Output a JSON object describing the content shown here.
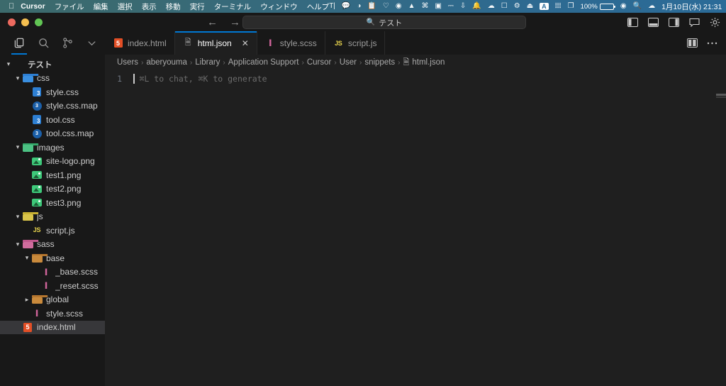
{
  "menubar": {
    "apple_icon": "apple-icon",
    "items": [
      "Cursor",
      "ファイル",
      "編集",
      "選択",
      "表示",
      "移動",
      "実行",
      "ターミナル",
      "ウィンドウ",
      "ヘルプ"
    ],
    "status_icons": [
      "text-input-icon",
      "speech-bubble-icon",
      "pie-chart-icon",
      "clipboard-icon",
      "heart-pulse-icon",
      "colorwheel-icon",
      "dropbox-icon",
      "command-icon",
      "screenshot-icon",
      "keyboard-icon",
      "download-icon",
      "notification-bell-icon",
      "vpn-icon",
      "display-icon",
      "screen-mirroring-icon",
      "control-center-icon",
      "eject-icon"
    ],
    "input_source": "A",
    "bluetooth_icon": "bluetooth-icon",
    "display_icon": "display-duplicate-icon",
    "battery_percent": "100%",
    "wifi_icon": "wifi-icon",
    "search_icon": "spotlight-icon",
    "siri_icon": "siri-icon",
    "datetime": "1月10日(水) 21:31"
  },
  "titlebar": {
    "back_icon": "back-arrow-icon",
    "forward_icon": "forward-arrow-icon",
    "quickpick_icon": "search-icon",
    "quickpick_value": "テスト",
    "actions": [
      {
        "name": "toggle-primary-sidebar-button",
        "icon": "layout-sidebar-left-icon"
      },
      {
        "name": "toggle-panel-button",
        "icon": "layout-panel-icon"
      },
      {
        "name": "toggle-secondary-sidebar-button",
        "icon": "layout-sidebar-right-icon"
      },
      {
        "name": "toggle-chat-button",
        "icon": "chat-panel-icon"
      },
      {
        "name": "settings-button",
        "icon": "gear-icon"
      }
    ]
  },
  "activitybar": {
    "items": [
      {
        "name": "explorer-icon",
        "label": "Explorer",
        "active": true
      },
      {
        "name": "search-icon",
        "label": "Search",
        "active": false
      },
      {
        "name": "source-control-icon",
        "label": "Source Control",
        "active": false
      },
      {
        "name": "chevron-down-icon",
        "label": "More",
        "active": false
      }
    ]
  },
  "explorer": {
    "tree": [
      {
        "label": "テスト",
        "depth": 0,
        "kind": "root",
        "twisty": "open",
        "selected": false
      },
      {
        "label": "css",
        "depth": 1,
        "kind": "folder-css",
        "twisty": "open",
        "selected": false
      },
      {
        "label": "style.css",
        "depth": 2,
        "kind": "css",
        "twisty": "none",
        "selected": false
      },
      {
        "label": "style.css.map",
        "depth": 2,
        "kind": "cssmap",
        "twisty": "none",
        "selected": false
      },
      {
        "label": "tool.css",
        "depth": 2,
        "kind": "css",
        "twisty": "none",
        "selected": false
      },
      {
        "label": "tool.css.map",
        "depth": 2,
        "kind": "cssmap",
        "twisty": "none",
        "selected": false
      },
      {
        "label": "images",
        "depth": 1,
        "kind": "folder-images",
        "twisty": "open",
        "selected": false
      },
      {
        "label": "site-logo.png",
        "depth": 2,
        "kind": "image",
        "twisty": "none",
        "selected": false
      },
      {
        "label": "test1.png",
        "depth": 2,
        "kind": "image",
        "twisty": "none",
        "selected": false
      },
      {
        "label": "test2.png",
        "depth": 2,
        "kind": "image",
        "twisty": "none",
        "selected": false
      },
      {
        "label": "test3.png",
        "depth": 2,
        "kind": "image",
        "twisty": "none",
        "selected": false
      },
      {
        "label": "js",
        "depth": 1,
        "kind": "folder-js",
        "twisty": "open",
        "selected": false
      },
      {
        "label": "script.js",
        "depth": 2,
        "kind": "js",
        "twisty": "none",
        "selected": false
      },
      {
        "label": "sass",
        "depth": 1,
        "kind": "folder-sass",
        "twisty": "open",
        "selected": false
      },
      {
        "label": "base",
        "depth": 2,
        "kind": "folder-base",
        "twisty": "open",
        "selected": false
      },
      {
        "label": "_base.scss",
        "depth": 3,
        "kind": "sass",
        "twisty": "none",
        "selected": false
      },
      {
        "label": "_reset.scss",
        "depth": 3,
        "kind": "sass",
        "twisty": "none",
        "selected": false
      },
      {
        "label": "global",
        "depth": 2,
        "kind": "folder-base",
        "twisty": "closed",
        "selected": false
      },
      {
        "label": "style.scss",
        "depth": 2,
        "kind": "sass",
        "twisty": "none",
        "selected": false
      },
      {
        "label": "index.html",
        "depth": 1,
        "kind": "html",
        "twisty": "none",
        "selected": true
      }
    ]
  },
  "tabs": [
    {
      "label": "index.html",
      "kind": "html",
      "active": false,
      "closable": false
    },
    {
      "label": "html.json",
      "kind": "json",
      "active": true,
      "closable": true,
      "close_icon": "close-icon"
    },
    {
      "label": "style.scss",
      "kind": "sass",
      "active": false,
      "closable": false
    },
    {
      "label": "script.js",
      "kind": "js",
      "active": false,
      "closable": false
    }
  ],
  "tabbar_actions": [
    {
      "name": "split-editor-button",
      "icon": "split-editor-icon"
    },
    {
      "name": "more-actions-button",
      "icon": "ellipsis-icon"
    }
  ],
  "breadcrumb": {
    "separator": "›",
    "crumbs": [
      "Users",
      "aberyouma",
      "Library",
      "Application Support",
      "Cursor",
      "User",
      "snippets"
    ],
    "file": "html.json",
    "file_icon": "json-file-icon"
  },
  "code": {
    "line_number": "1",
    "ghost_text": "⌘L to chat, ⌘K to generate"
  },
  "colors": {
    "accent": "#0078d4",
    "sidebar_bg": "#181818",
    "editor_bg": "#1f1f1f",
    "selection_bg": "#37373a",
    "html_icon": "#e34f26",
    "css_icon": "#2d7fd3",
    "js_icon": "#e8d44d",
    "sass_icon": "#cf649a",
    "image_icon": "#3ec97a"
  }
}
